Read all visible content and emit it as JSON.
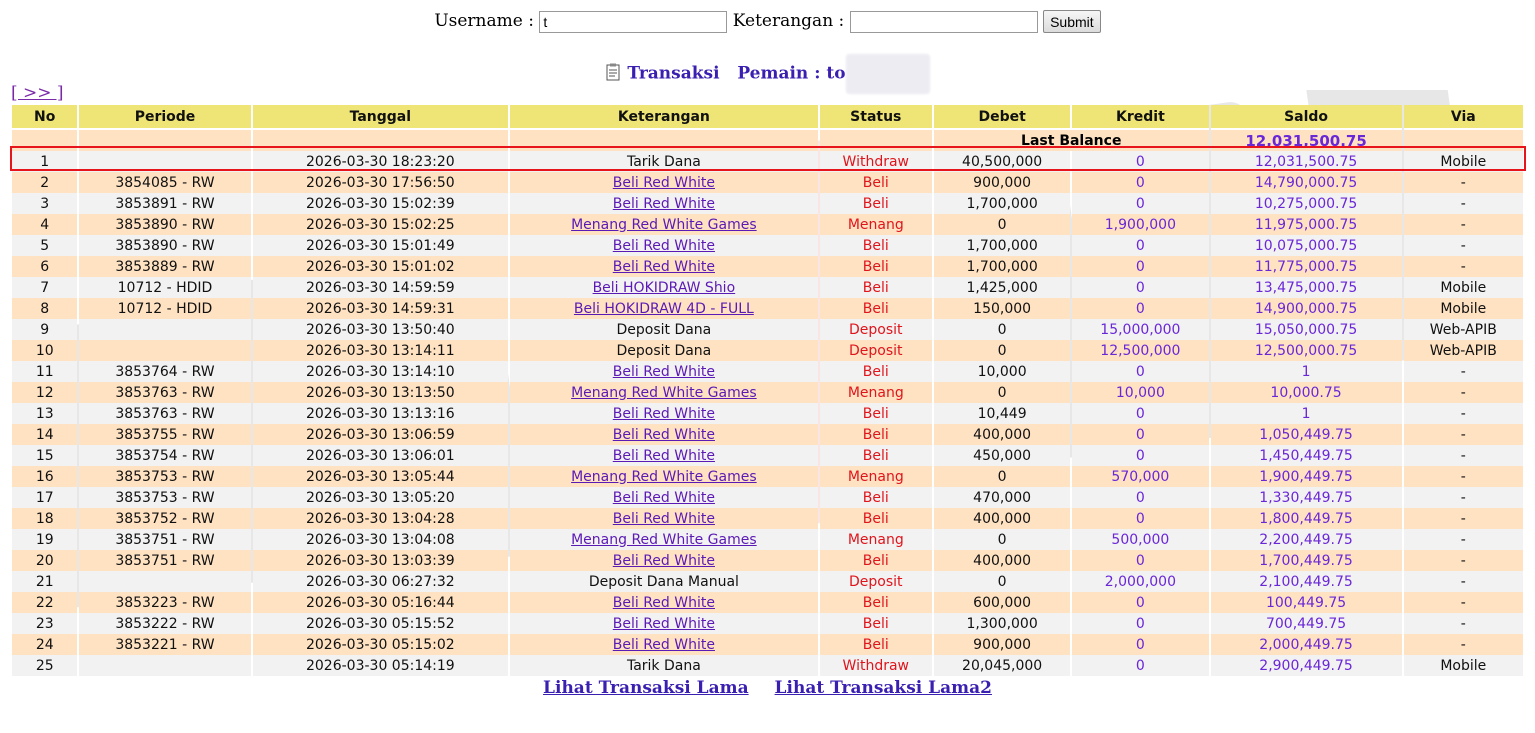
{
  "form": {
    "username_label": "Username :",
    "username_value": "t",
    "keterangan_label": "Keterangan :",
    "keterangan_value": "",
    "submit_label": "Submit"
  },
  "title": {
    "transaksi": "Transaksi",
    "pemain_label": "Pemain : to"
  },
  "nav": {
    "next": "[ >> ]"
  },
  "table": {
    "headers": [
      "No",
      "Periode",
      "Tanggal",
      "Keterangan",
      "Status",
      "Debet",
      "Kredit",
      "Saldo",
      "Via"
    ],
    "last_balance_label": "Last Balance",
    "last_balance_value": "12,031,500.75",
    "rows": [
      {
        "no": "1",
        "periode": "",
        "tanggal": "2026-03-30 18:23:20",
        "ket": "Tarik Dana",
        "status": "Withdraw",
        "debet": "40,500,000",
        "kredit": "0",
        "saldo": "12,031,500.75",
        "via": "Mobile"
      },
      {
        "no": "2",
        "periode": "3854085 - RW",
        "tanggal": "2026-03-30 17:56:50",
        "ket": "Beli Red White",
        "status": "Beli",
        "debet": "900,000",
        "kredit": "0",
        "saldo": "14,790,000.75",
        "via": "-"
      },
      {
        "no": "3",
        "periode": "3853891 - RW",
        "tanggal": "2026-03-30 15:02:39",
        "ket": "Beli Red White",
        "status": "Beli",
        "debet": "1,700,000",
        "kredit": "0",
        "saldo": "10,275,000.75",
        "via": "-"
      },
      {
        "no": "4",
        "periode": "3853890 - RW",
        "tanggal": "2026-03-30 15:02:25",
        "ket": "Menang Red White Games",
        "status": "Menang",
        "debet": "0",
        "kredit": "1,900,000",
        "saldo": "11,975,000.75",
        "via": "-"
      },
      {
        "no": "5",
        "periode": "3853890 - RW",
        "tanggal": "2026-03-30 15:01:49",
        "ket": "Beli Red White",
        "status": "Beli",
        "debet": "1,700,000",
        "kredit": "0",
        "saldo": "10,075,000.75",
        "via": "-"
      },
      {
        "no": "6",
        "periode": "3853889 - RW",
        "tanggal": "2026-03-30 15:01:02",
        "ket": "Beli Red White",
        "status": "Beli",
        "debet": "1,700,000",
        "kredit": "0",
        "saldo": "11,775,000.75",
        "via": "-"
      },
      {
        "no": "7",
        "periode": "10712 - HDID",
        "tanggal": "2026-03-30 14:59:59",
        "ket": "Beli HOKIDRAW Shio",
        "status": "Beli",
        "debet": "1,425,000",
        "kredit": "0",
        "saldo": "13,475,000.75",
        "via": "Mobile"
      },
      {
        "no": "8",
        "periode": "10712 - HDID",
        "tanggal": "2026-03-30 14:59:31",
        "ket": "Beli HOKIDRAW 4D - FULL",
        "status": "Beli",
        "debet": "150,000",
        "kredit": "0",
        "saldo": "14,900,000.75",
        "via": "Mobile"
      },
      {
        "no": "9",
        "periode": "",
        "tanggal": "2026-03-30 13:50:40",
        "ket": "Deposit Dana",
        "status": "Deposit",
        "debet": "0",
        "kredit": "15,000,000",
        "saldo": "15,050,000.75",
        "via": "Web-APIB"
      },
      {
        "no": "10",
        "periode": "",
        "tanggal": "2026-03-30 13:14:11",
        "ket": "Deposit Dana",
        "status": "Deposit",
        "debet": "0",
        "kredit": "12,500,000",
        "saldo": "12,500,000.75",
        "via": "Web-APIB"
      },
      {
        "no": "11",
        "periode": "3853764 - RW",
        "tanggal": "2026-03-30 13:14:10",
        "ket": "Beli Red White",
        "status": "Beli",
        "debet": "10,000",
        "kredit": "0",
        "saldo": "1",
        "via": "-"
      },
      {
        "no": "12",
        "periode": "3853763 - RW",
        "tanggal": "2026-03-30 13:13:50",
        "ket": "Menang Red White Games",
        "status": "Menang",
        "debet": "0",
        "kredit": "10,000",
        "saldo": "10,000.75",
        "via": "-"
      },
      {
        "no": "13",
        "periode": "3853763 - RW",
        "tanggal": "2026-03-30 13:13:16",
        "ket": "Beli Red White",
        "status": "Beli",
        "debet": "10,449",
        "kredit": "0",
        "saldo": "1",
        "via": "-"
      },
      {
        "no": "14",
        "periode": "3853755 - RW",
        "tanggal": "2026-03-30 13:06:59",
        "ket": "Beli Red White",
        "status": "Beli",
        "debet": "400,000",
        "kredit": "0",
        "saldo": "1,050,449.75",
        "via": "-"
      },
      {
        "no": "15",
        "periode": "3853754 - RW",
        "tanggal": "2026-03-30 13:06:01",
        "ket": "Beli Red White",
        "status": "Beli",
        "debet": "450,000",
        "kredit": "0",
        "saldo": "1,450,449.75",
        "via": "-"
      },
      {
        "no": "16",
        "periode": "3853753 - RW",
        "tanggal": "2026-03-30 13:05:44",
        "ket": "Menang Red White Games",
        "status": "Menang",
        "debet": "0",
        "kredit": "570,000",
        "saldo": "1,900,449.75",
        "via": "-"
      },
      {
        "no": "17",
        "periode": "3853753 - RW",
        "tanggal": "2026-03-30 13:05:20",
        "ket": "Beli Red White",
        "status": "Beli",
        "debet": "470,000",
        "kredit": "0",
        "saldo": "1,330,449.75",
        "via": "-"
      },
      {
        "no": "18",
        "periode": "3853752 - RW",
        "tanggal": "2026-03-30 13:04:28",
        "ket": "Beli Red White",
        "status": "Beli",
        "debet": "400,000",
        "kredit": "0",
        "saldo": "1,800,449.75",
        "via": "-"
      },
      {
        "no": "19",
        "periode": "3853751 - RW",
        "tanggal": "2026-03-30 13:04:08",
        "ket": "Menang Red White Games",
        "status": "Menang",
        "debet": "0",
        "kredit": "500,000",
        "saldo": "2,200,449.75",
        "via": "-"
      },
      {
        "no": "20",
        "periode": "3853751 - RW",
        "tanggal": "2026-03-30 13:03:39",
        "ket": "Beli Red White",
        "status": "Beli",
        "debet": "400,000",
        "kredit": "0",
        "saldo": "1,700,449.75",
        "via": "-"
      },
      {
        "no": "21",
        "periode": "",
        "tanggal": "2026-03-30 06:27:32",
        "ket": "Deposit Dana Manual",
        "status": "Deposit",
        "debet": "0",
        "kredit": "2,000,000",
        "saldo": "2,100,449.75",
        "via": "-"
      },
      {
        "no": "22",
        "periode": "3853223 - RW",
        "tanggal": "2026-03-30 05:16:44",
        "ket": "Beli Red White",
        "status": "Beli",
        "debet": "600,000",
        "kredit": "0",
        "saldo": "100,449.75",
        "via": "-"
      },
      {
        "no": "23",
        "periode": "3853222 - RW",
        "tanggal": "2026-03-30 05:15:52",
        "ket": "Beli Red White",
        "status": "Beli",
        "debet": "1,300,000",
        "kredit": "0",
        "saldo": "700,449.75",
        "via": "-"
      },
      {
        "no": "24",
        "periode": "3853221 - RW",
        "tanggal": "2026-03-30 05:15:02",
        "ket": "Beli Red White",
        "status": "Beli",
        "debet": "900,000",
        "kredit": "0",
        "saldo": "2,000,449.75",
        "via": "-"
      },
      {
        "no": "25",
        "periode": "",
        "tanggal": "2026-03-30 05:14:19",
        "ket": "Tarik Dana",
        "status": "Withdraw",
        "debet": "20,045,000",
        "kredit": "0",
        "saldo": "2,900,449.75",
        "via": "Mobile"
      }
    ]
  },
  "bottom_links": {
    "lama": "Lihat Transaksi Lama",
    "lama2": "Lihat Transaksi Lama2"
  },
  "colors": {
    "header_bg": "#eee576",
    "row_odd": "#ffe2c2",
    "row_even": "#f2f2f2",
    "status_red": "#e0151c",
    "purple": "#6a27d8",
    "highlight": "#e8141c"
  }
}
